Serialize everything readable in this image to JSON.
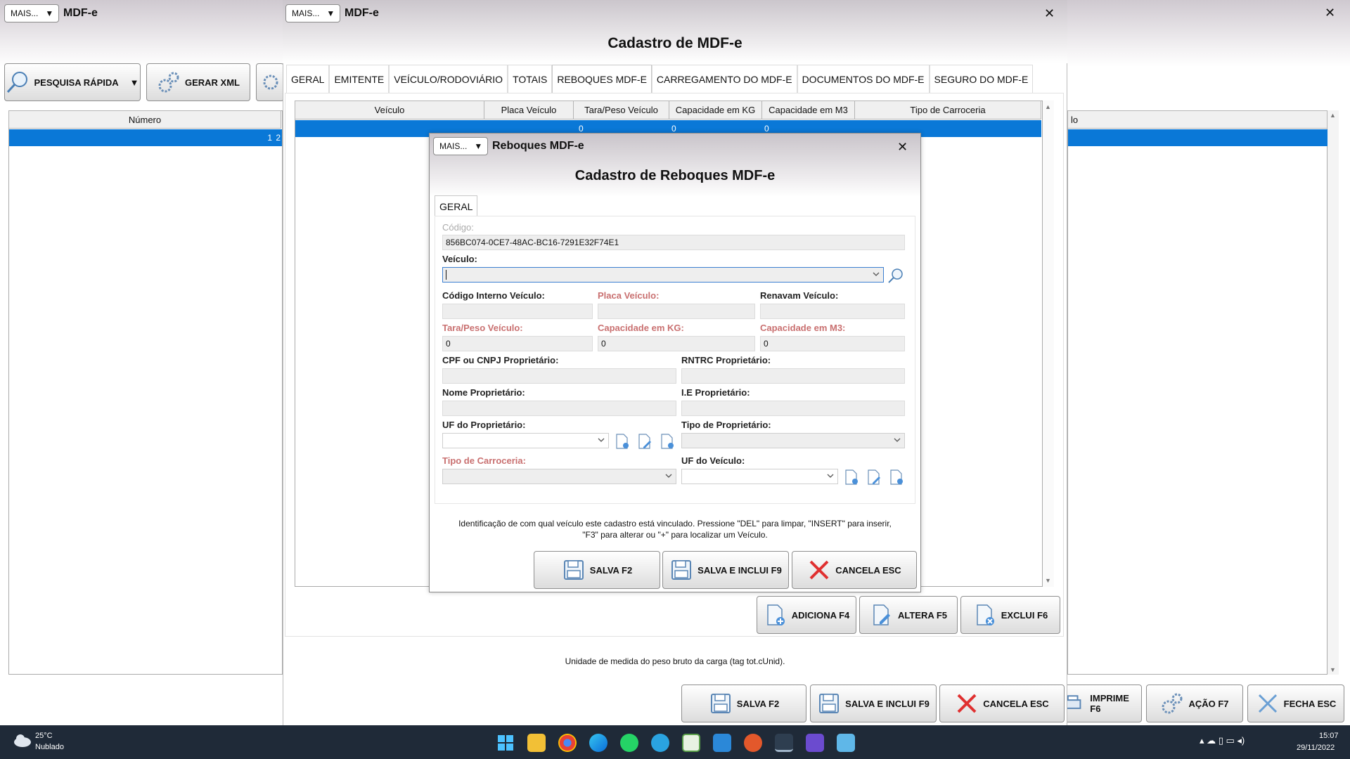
{
  "main_window": {
    "mais_label": "MAIS...",
    "title": "MDF-e",
    "toolbar": {
      "pesquisa": "PESQUISA RÁPIDA",
      "gerar_xml": "GERAR XML"
    },
    "grid": {
      "col_numero": "Número",
      "col_right": "lo",
      "row_value": "1",
      "row_value2": "2"
    },
    "footer_buttons": {
      "imprime": "IMPRIME F6",
      "acao": "AÇÃO F7",
      "fecha": "FECHA ESC"
    }
  },
  "cadastro_window": {
    "mais_label": "MAIS...",
    "title": "MDF-e",
    "heading": "Cadastro de MDF-e",
    "tabs": [
      {
        "label": "GERAL"
      },
      {
        "label": "EMITENTE"
      },
      {
        "label": "VEÍCULO/RODOVIÁRIO"
      },
      {
        "label": "TOTAIS"
      },
      {
        "label": "REBOQUES MDF-E"
      },
      {
        "label": "CARREGAMENTO DO MDF-E"
      },
      {
        "label": "DOCUMENTOS DO MDF-E"
      },
      {
        "label": "SEGURO DO MDF-E"
      }
    ],
    "grid_columns": [
      "Veículo",
      "Placa Veículo",
      "Tara/Peso Veículo",
      "Capacidade em KG",
      "Capacidade em M3",
      "Tipo de Carroceria"
    ],
    "grid_row": [
      "",
      "",
      "0",
      "0",
      "0",
      ""
    ],
    "grid_buttons": {
      "adiciona": "ADICIONA F4",
      "altera": "ALTERA F5",
      "exclui": "EXCLUI F6"
    },
    "hint": "Unidade de medida do peso bruto da carga (tag tot.cUnid).",
    "buttons": {
      "salva": "SALVA F2",
      "salva_inclui": "SALVA E INCLUI F9",
      "cancela": "CANCELA ESC"
    }
  },
  "reboques_dialog": {
    "mais_label": "MAIS...",
    "title": "Reboques MDF-e",
    "heading": "Cadastro de Reboques MDF-e",
    "tab": "GERAL",
    "fields": {
      "codigo_label": "Código:",
      "codigo_value": "856BC074-0CE7-48AC-BC16-7291E32F74E1",
      "veiculo_label": "Veículo:",
      "veiculo_value": "",
      "cod_interno_label": "Código Interno Veículo:",
      "placa_label": "Placa Veículo:",
      "renavam_label": "Renavam Veículo:",
      "tara_label": "Tara/Peso Veículo:",
      "tara_value": "0",
      "cap_kg_label": "Capacidade em KG:",
      "cap_kg_value": "0",
      "cap_m3_label": "Capacidade em M3:",
      "cap_m3_value": "0",
      "cpf_label": "CPF ou CNPJ Proprietário:",
      "rntrc_label": "RNTRC Proprietário:",
      "nome_label": "Nome Proprietário:",
      "ie_label": "I.E Proprietário:",
      "uf_prop_label": "UF do Proprietário:",
      "tipo_prop_label": "Tipo de Proprietário:",
      "tipo_carroceria_label": "Tipo de Carroceria:",
      "uf_veiculo_label": "UF do Veículo:"
    },
    "hint_line1": "Identificação de com qual veículo este cadastro está vinculado. Pressione \"DEL\" para limpar, \"INSERT\" para inserir,",
    "hint_line2": "\"F3\" para alterar ou \"+\" para localizar um Veículo.",
    "buttons": {
      "salva": "SALVA F2",
      "salva_inclui": "SALVA E INCLUI F9",
      "cancela": "CANCELA ESC"
    }
  },
  "taskbar": {
    "weather_temp": "25°C",
    "weather_desc": "Nublado",
    "time": "15:07",
    "date": "29/11/2022"
  },
  "colors": {
    "selection": "#0a78d7",
    "taskbar": "#1f2a38",
    "required_label": "#c97070"
  }
}
